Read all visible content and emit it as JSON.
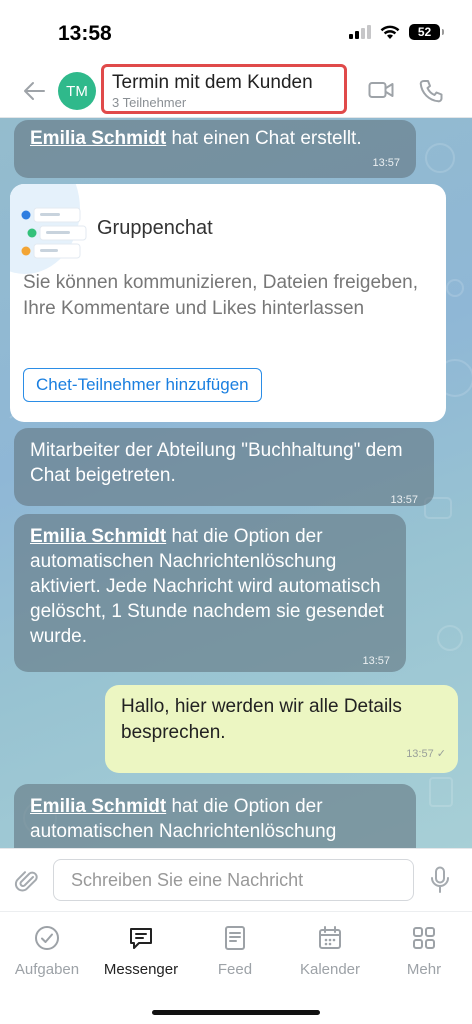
{
  "status": {
    "time": "13:58",
    "battery": "52"
  },
  "header": {
    "avatar_initials": "TM",
    "title": "Termin mit dem Kunden",
    "subtitle": "3 Teilnehmer"
  },
  "messages": {
    "m1": {
      "name": "Emilia Schmidt",
      "text": " hat einen Chat erstellt.",
      "time": "13:57"
    },
    "card": {
      "title": "Gruppenchat",
      "description": "Sie können kommunizieren, Dateien freigeben, Ihre Kommentare und Likes hinterlassen",
      "button": "Chet-Teilnehmer hinzufügen"
    },
    "m2": {
      "text": "Mitarbeiter der Abteilung \"Buchhaltung\" dem Chat beigetreten.",
      "time": "13:57"
    },
    "m3": {
      "name": "Emilia Schmidt",
      "text": " hat die Option der automatischen Nachrichtenlöschung aktiviert. Jede Nachricht wird automatisch gelöscht, 1 Stunde nachdem sie gesendet wurde.",
      "time": "13:57"
    },
    "m4": {
      "text": "Hallo, hier werden wir alle Details besprechen.",
      "time": "13:57 ✓"
    },
    "m5": {
      "name": "Emilia Schmidt",
      "text": " hat die Option der automatischen Nachrichtenlöschung deaktiviert. Neue Nachrichten werden"
    }
  },
  "composer": {
    "placeholder": "Schreiben Sie eine Nachricht"
  },
  "tabs": [
    {
      "label": "Aufgaben",
      "icon": "check-circle-icon"
    },
    {
      "label": "Messenger",
      "icon": "chat-bubble-icon"
    },
    {
      "label": "Feed",
      "icon": "feed-icon"
    },
    {
      "label": "Kalender",
      "icon": "calendar-icon"
    },
    {
      "label": "Mehr",
      "icon": "grid-icon"
    }
  ],
  "colors": {
    "accent": "#1a7fe0",
    "avatar": "#2fb98b",
    "outgoing_bubble": "#ecf6c2",
    "highlight_border": "#e04a4a"
  }
}
